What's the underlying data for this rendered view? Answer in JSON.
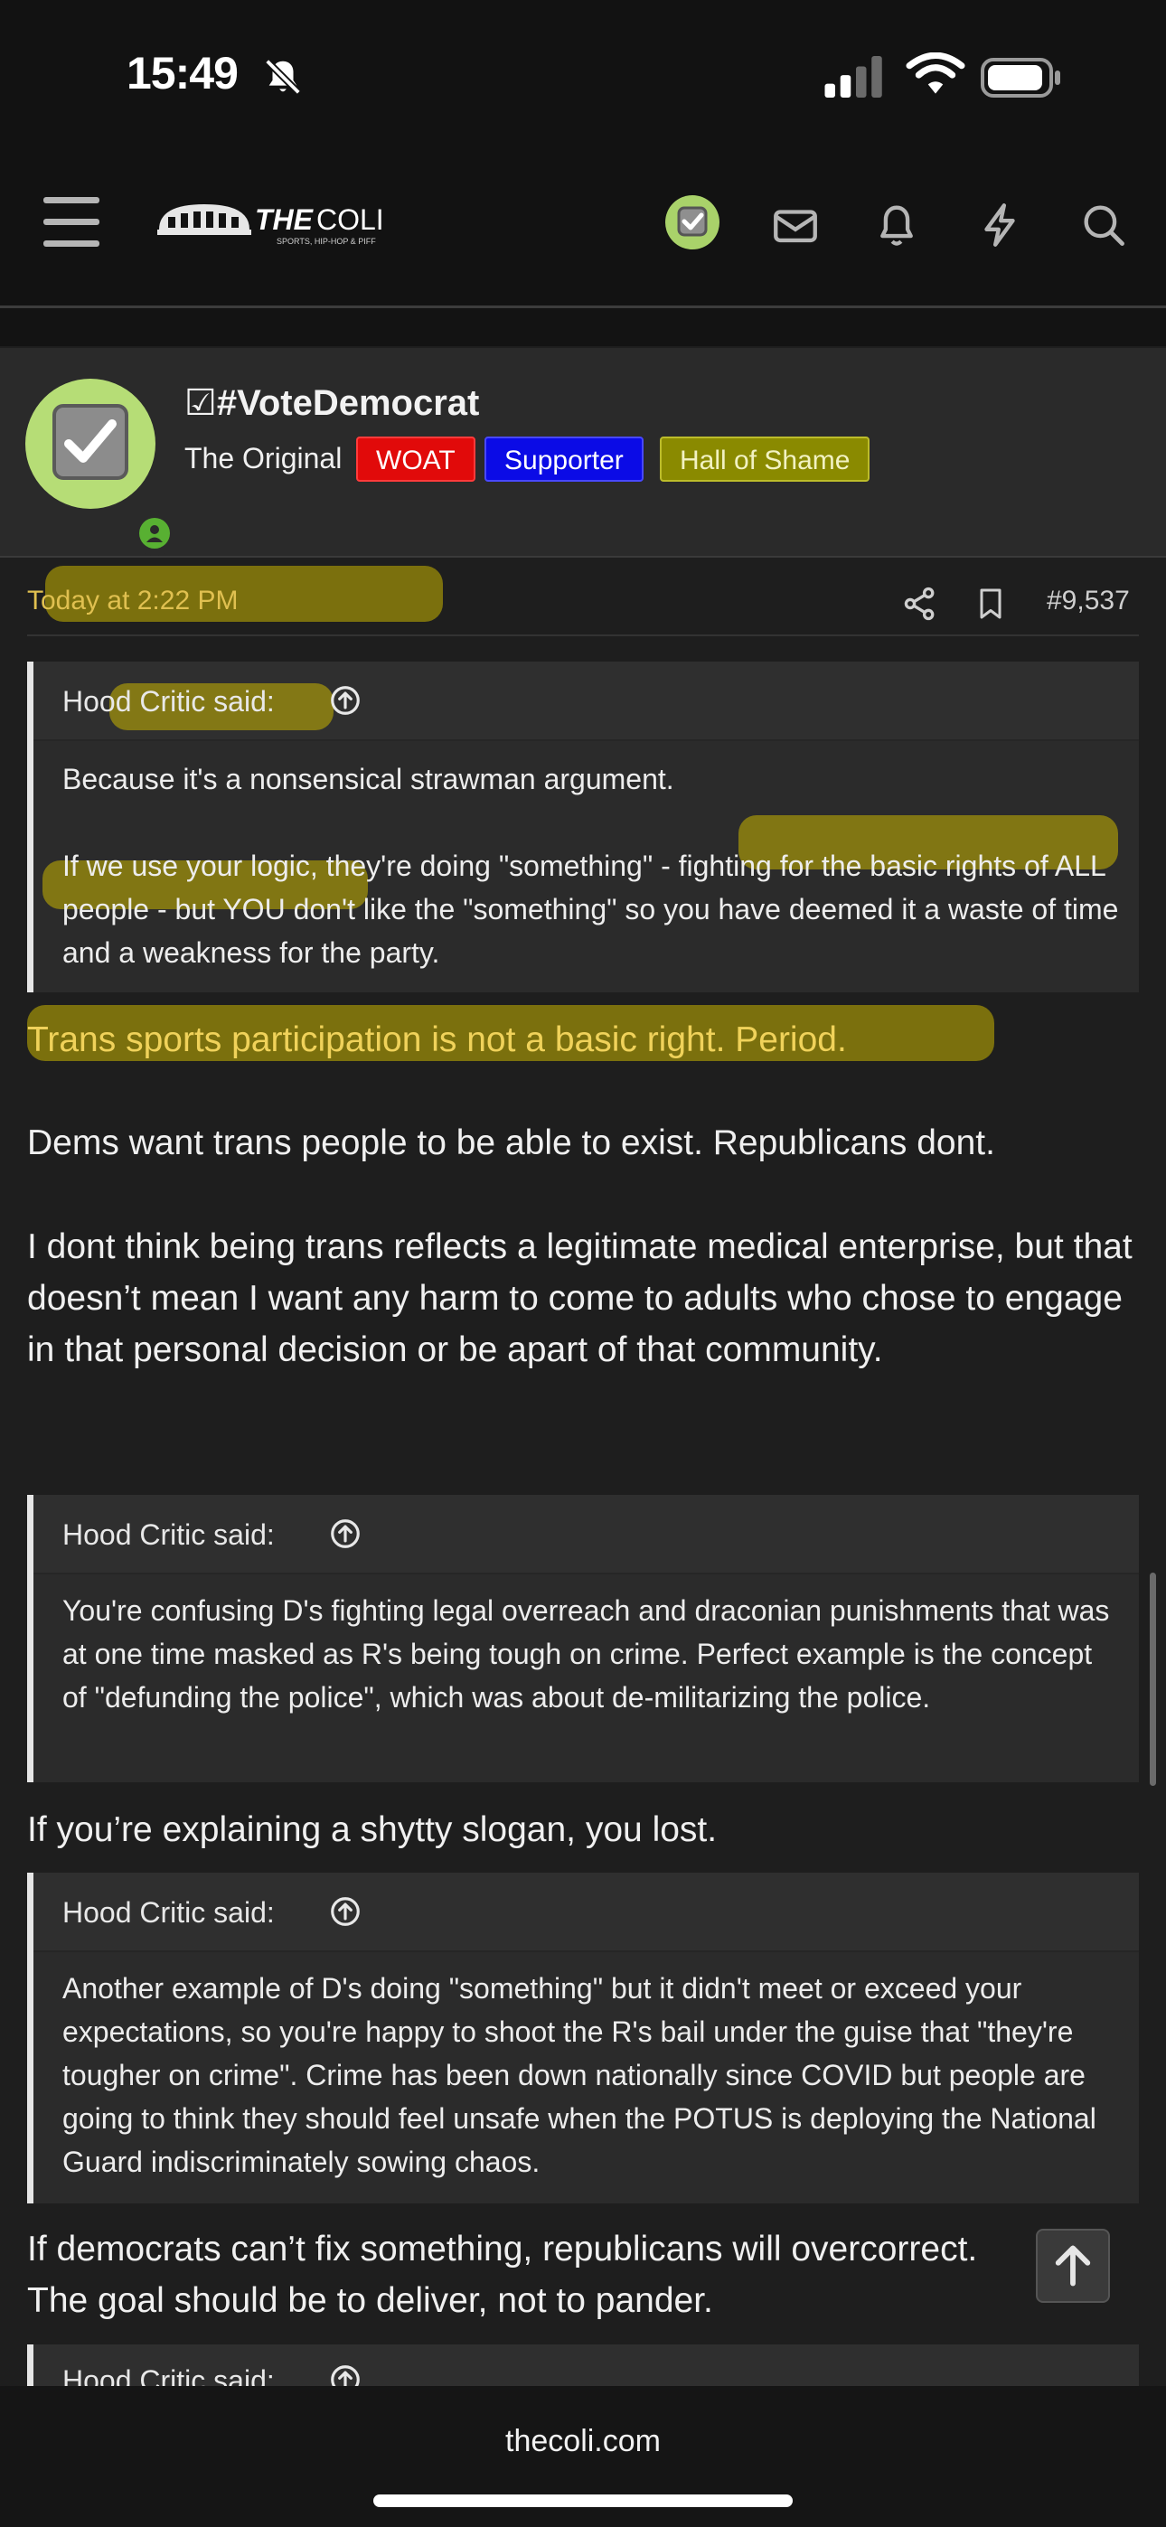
{
  "status_bar": {
    "time": "15:49"
  },
  "nav": {
    "icons": [
      "menu-icon",
      "mail-icon",
      "bell-icon",
      "lightning-icon",
      "search-icon"
    ],
    "logo_text": "THE COLI",
    "logo_tagline": "SPORTS, HIP-HOP & PIFF"
  },
  "post": {
    "username": "☑#VoteDemocrat",
    "user_title": "The Original",
    "badges": [
      "WOAT",
      "Supporter",
      "Hall of Shame"
    ],
    "date": "Today at 2:22 PM",
    "post_number": "#9,537",
    "quotes": [
      {
        "author": "Hood Critic said:",
        "paragraphs": [
          "Because it's a nonsensical strawman argument.",
          "If we use your logic, they're doing \"something\" - fighting for the basic rights of ALL people - but YOU don't like the \"something\" so you have deemed it a waste of time and a weakness for the party."
        ]
      },
      {
        "author": "Hood Critic said:",
        "paragraphs": [
          "You're confusing D's fighting legal overreach and draconian punishments that was at one time masked as R's being tough on crime. Perfect example is the concept of \"defunding the police\", which was about de-militarizing the police."
        ]
      },
      {
        "author": "Hood Critic said:",
        "paragraphs": [
          "Another example of D's doing \"something\" but it didn't meet or exceed your expectations, so you're happy to shoot the R's bail under the guise that \"they're tougher on crime\". Crime has been down nationally since COVID but people are going to think they should feel unsafe when the POTUS is deploying the National Guard indiscriminately sowing chaos."
        ]
      },
      {
        "author": "Hood Critic said:"
      }
    ],
    "replies": [
      "Trans sports participation is not a basic right. Period.",
      "Dems want trans people to be able to exist. Republicans dont.",
      "I dont think being trans reflects a legitimate medical enterprise, but that doesn’t mean I want any harm to come to adults who chose to engage in that personal decision or be apart of that community.",
      "If you’re explaining a shytty slogan, you lost.",
      "If democrats can’t fix something, republicans will overcorrect.",
      "The goal should be to deliver, not to pander."
    ]
  },
  "browser": {
    "url": "thecoli.com"
  },
  "colors": {
    "highlight": "#c8b400",
    "avatar_bg": "#b6dd76",
    "online": "#58b032"
  }
}
